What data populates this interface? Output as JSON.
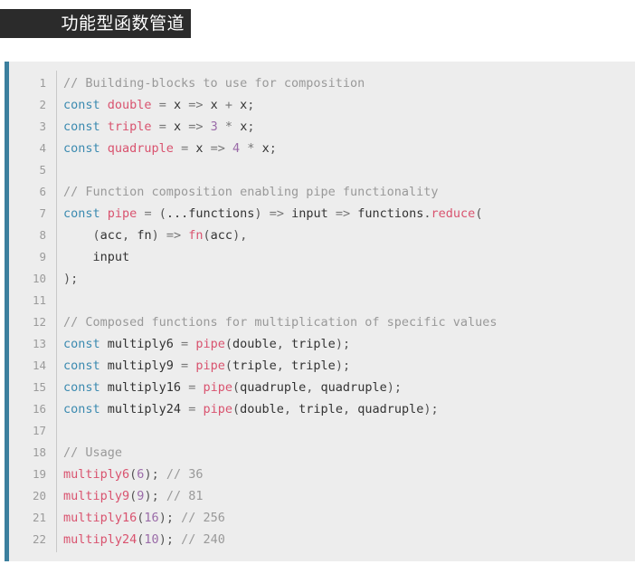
{
  "title": {
    "text": "功能型函数管道"
  },
  "theme": {
    "page_background": "#ffffff",
    "title_background": "#2b2b2b",
    "title_color": "#ffffff",
    "code_background": "#ededed",
    "code_accent_border": "#3b7f9e",
    "gutter_color": "#9b9b9b",
    "comment_color": "#999999",
    "keyword_color": "#3b8ab0",
    "function_color": "#d9536f",
    "number_color": "#9a6ba8",
    "text_color": "#333333"
  },
  "code": {
    "language": "javascript",
    "first_line_number": 1,
    "last_line_number": 22,
    "line_numbers": [
      1,
      2,
      3,
      4,
      5,
      6,
      7,
      8,
      9,
      10,
      11,
      12,
      13,
      14,
      15,
      16,
      17,
      18,
      19,
      20,
      21,
      22
    ],
    "lines": [
      {
        "n": 1,
        "plain": "// Building-blocks to use for composition",
        "tokens": [
          {
            "t": "// Building-blocks to use for composition",
            "c": "comment"
          }
        ]
      },
      {
        "n": 2,
        "plain": "const double = x => x + x;",
        "tokens": [
          {
            "t": "const",
            "c": "keyword"
          },
          {
            "t": " ",
            "c": "plain"
          },
          {
            "t": "double",
            "c": "fn"
          },
          {
            "t": " ",
            "c": "plain"
          },
          {
            "t": "=",
            "c": "op"
          },
          {
            "t": " x ",
            "c": "plain"
          },
          {
            "t": "=>",
            "c": "op"
          },
          {
            "t": " x ",
            "c": "plain"
          },
          {
            "t": "+",
            "c": "op"
          },
          {
            "t": " x",
            "c": "plain"
          },
          {
            "t": ";",
            "c": "punct"
          }
        ]
      },
      {
        "n": 3,
        "plain": "const triple = x => 3 * x;",
        "tokens": [
          {
            "t": "const",
            "c": "keyword"
          },
          {
            "t": " ",
            "c": "plain"
          },
          {
            "t": "triple",
            "c": "fn"
          },
          {
            "t": " ",
            "c": "plain"
          },
          {
            "t": "=",
            "c": "op"
          },
          {
            "t": " x ",
            "c": "plain"
          },
          {
            "t": "=>",
            "c": "op"
          },
          {
            "t": " ",
            "c": "plain"
          },
          {
            "t": "3",
            "c": "num"
          },
          {
            "t": " ",
            "c": "plain"
          },
          {
            "t": "*",
            "c": "op"
          },
          {
            "t": " x",
            "c": "plain"
          },
          {
            "t": ";",
            "c": "punct"
          }
        ]
      },
      {
        "n": 4,
        "plain": "const quadruple = x => 4 * x;",
        "tokens": [
          {
            "t": "const",
            "c": "keyword"
          },
          {
            "t": " ",
            "c": "plain"
          },
          {
            "t": "quadruple",
            "c": "fn"
          },
          {
            "t": " ",
            "c": "plain"
          },
          {
            "t": "=",
            "c": "op"
          },
          {
            "t": " x ",
            "c": "plain"
          },
          {
            "t": "=>",
            "c": "op"
          },
          {
            "t": " ",
            "c": "plain"
          },
          {
            "t": "4",
            "c": "num"
          },
          {
            "t": " ",
            "c": "plain"
          },
          {
            "t": "*",
            "c": "op"
          },
          {
            "t": " x",
            "c": "plain"
          },
          {
            "t": ";",
            "c": "punct"
          }
        ]
      },
      {
        "n": 5,
        "plain": "",
        "tokens": []
      },
      {
        "n": 6,
        "plain": "// Function composition enabling pipe functionality",
        "tokens": [
          {
            "t": "// Function composition enabling pipe functionality",
            "c": "comment"
          }
        ]
      },
      {
        "n": 7,
        "plain": "const pipe = (...functions) => input => functions.reduce(",
        "tokens": [
          {
            "t": "const",
            "c": "keyword"
          },
          {
            "t": " ",
            "c": "plain"
          },
          {
            "t": "pipe",
            "c": "fn"
          },
          {
            "t": " ",
            "c": "plain"
          },
          {
            "t": "=",
            "c": "op"
          },
          {
            "t": " ",
            "c": "plain"
          },
          {
            "t": "(",
            "c": "punct"
          },
          {
            "t": "...functions",
            "c": "plain"
          },
          {
            "t": ")",
            "c": "punct"
          },
          {
            "t": " ",
            "c": "plain"
          },
          {
            "t": "=>",
            "c": "op"
          },
          {
            "t": " input ",
            "c": "plain"
          },
          {
            "t": "=>",
            "c": "op"
          },
          {
            "t": " functions",
            "c": "plain"
          },
          {
            "t": ".",
            "c": "punct"
          },
          {
            "t": "reduce",
            "c": "fn"
          },
          {
            "t": "(",
            "c": "punct"
          }
        ]
      },
      {
        "n": 8,
        "plain": "    (acc, fn) => fn(acc),",
        "tokens": [
          {
            "t": "    ",
            "c": "plain"
          },
          {
            "t": "(",
            "c": "punct"
          },
          {
            "t": "acc",
            "c": "plain"
          },
          {
            "t": ",",
            "c": "punct"
          },
          {
            "t": " fn",
            "c": "plain"
          },
          {
            "t": ")",
            "c": "punct"
          },
          {
            "t": " ",
            "c": "plain"
          },
          {
            "t": "=>",
            "c": "op"
          },
          {
            "t": " ",
            "c": "plain"
          },
          {
            "t": "fn",
            "c": "fn"
          },
          {
            "t": "(",
            "c": "punct"
          },
          {
            "t": "acc",
            "c": "plain"
          },
          {
            "t": ")",
            "c": "punct"
          },
          {
            "t": ",",
            "c": "punct"
          }
        ]
      },
      {
        "n": 9,
        "plain": "    input",
        "tokens": [
          {
            "t": "    input",
            "c": "plain"
          }
        ]
      },
      {
        "n": 10,
        "plain": ");",
        "tokens": [
          {
            "t": ")",
            "c": "punct"
          },
          {
            "t": ";",
            "c": "punct"
          }
        ]
      },
      {
        "n": 11,
        "plain": "",
        "tokens": []
      },
      {
        "n": 12,
        "plain": "// Composed functions for multiplication of specific values",
        "tokens": [
          {
            "t": "// Composed functions for multiplication of specific values",
            "c": "comment"
          }
        ]
      },
      {
        "n": 13,
        "plain": "const multiply6 = pipe(double, triple);",
        "tokens": [
          {
            "t": "const",
            "c": "keyword"
          },
          {
            "t": " multiply6 ",
            "c": "plain"
          },
          {
            "t": "=",
            "c": "op"
          },
          {
            "t": " ",
            "c": "plain"
          },
          {
            "t": "pipe",
            "c": "fn"
          },
          {
            "t": "(",
            "c": "punct"
          },
          {
            "t": "double",
            "c": "plain"
          },
          {
            "t": ",",
            "c": "punct"
          },
          {
            "t": " triple",
            "c": "plain"
          },
          {
            "t": ")",
            "c": "punct"
          },
          {
            "t": ";",
            "c": "punct"
          }
        ]
      },
      {
        "n": 14,
        "plain": "const multiply9 = pipe(triple, triple);",
        "tokens": [
          {
            "t": "const",
            "c": "keyword"
          },
          {
            "t": " multiply9 ",
            "c": "plain"
          },
          {
            "t": "=",
            "c": "op"
          },
          {
            "t": " ",
            "c": "plain"
          },
          {
            "t": "pipe",
            "c": "fn"
          },
          {
            "t": "(",
            "c": "punct"
          },
          {
            "t": "triple",
            "c": "plain"
          },
          {
            "t": ",",
            "c": "punct"
          },
          {
            "t": " triple",
            "c": "plain"
          },
          {
            "t": ")",
            "c": "punct"
          },
          {
            "t": ";",
            "c": "punct"
          }
        ]
      },
      {
        "n": 15,
        "plain": "const multiply16 = pipe(quadruple, quadruple);",
        "tokens": [
          {
            "t": "const",
            "c": "keyword"
          },
          {
            "t": " multiply16 ",
            "c": "plain"
          },
          {
            "t": "=",
            "c": "op"
          },
          {
            "t": " ",
            "c": "plain"
          },
          {
            "t": "pipe",
            "c": "fn"
          },
          {
            "t": "(",
            "c": "punct"
          },
          {
            "t": "quadruple",
            "c": "plain"
          },
          {
            "t": ",",
            "c": "punct"
          },
          {
            "t": " quadruple",
            "c": "plain"
          },
          {
            "t": ")",
            "c": "punct"
          },
          {
            "t": ";",
            "c": "punct"
          }
        ]
      },
      {
        "n": 16,
        "plain": "const multiply24 = pipe(double, triple, quadruple);",
        "tokens": [
          {
            "t": "const",
            "c": "keyword"
          },
          {
            "t": " multiply24 ",
            "c": "plain"
          },
          {
            "t": "=",
            "c": "op"
          },
          {
            "t": " ",
            "c": "plain"
          },
          {
            "t": "pipe",
            "c": "fn"
          },
          {
            "t": "(",
            "c": "punct"
          },
          {
            "t": "double",
            "c": "plain"
          },
          {
            "t": ",",
            "c": "punct"
          },
          {
            "t": " triple",
            "c": "plain"
          },
          {
            "t": ",",
            "c": "punct"
          },
          {
            "t": " quadruple",
            "c": "plain"
          },
          {
            "t": ")",
            "c": "punct"
          },
          {
            "t": ";",
            "c": "punct"
          }
        ]
      },
      {
        "n": 17,
        "plain": "",
        "tokens": []
      },
      {
        "n": 18,
        "plain": "// Usage",
        "tokens": [
          {
            "t": "// Usage",
            "c": "comment"
          }
        ]
      },
      {
        "n": 19,
        "plain": "multiply6(6); // 36",
        "tokens": [
          {
            "t": "multiply6",
            "c": "fn"
          },
          {
            "t": "(",
            "c": "punct"
          },
          {
            "t": "6",
            "c": "num"
          },
          {
            "t": ")",
            "c": "punct"
          },
          {
            "t": ";",
            "c": "punct"
          },
          {
            "t": " ",
            "c": "plain"
          },
          {
            "t": "// 36",
            "c": "comment"
          }
        ]
      },
      {
        "n": 20,
        "plain": "multiply9(9); // 81",
        "tokens": [
          {
            "t": "multiply9",
            "c": "fn"
          },
          {
            "t": "(",
            "c": "punct"
          },
          {
            "t": "9",
            "c": "num"
          },
          {
            "t": ")",
            "c": "punct"
          },
          {
            "t": ";",
            "c": "punct"
          },
          {
            "t": " ",
            "c": "plain"
          },
          {
            "t": "// 81",
            "c": "comment"
          }
        ]
      },
      {
        "n": 21,
        "plain": "multiply16(16); // 256",
        "tokens": [
          {
            "t": "multiply16",
            "c": "fn"
          },
          {
            "t": "(",
            "c": "punct"
          },
          {
            "t": "16",
            "c": "num"
          },
          {
            "t": ")",
            "c": "punct"
          },
          {
            "t": ";",
            "c": "punct"
          },
          {
            "t": " ",
            "c": "plain"
          },
          {
            "t": "// 256",
            "c": "comment"
          }
        ]
      },
      {
        "n": 22,
        "plain": "multiply24(10); // 240",
        "tokens": [
          {
            "t": "multiply24",
            "c": "fn"
          },
          {
            "t": "(",
            "c": "punct"
          },
          {
            "t": "10",
            "c": "num"
          },
          {
            "t": ")",
            "c": "punct"
          },
          {
            "t": ";",
            "c": "punct"
          },
          {
            "t": " ",
            "c": "plain"
          },
          {
            "t": "// 240",
            "c": "comment"
          }
        ]
      }
    ]
  }
}
